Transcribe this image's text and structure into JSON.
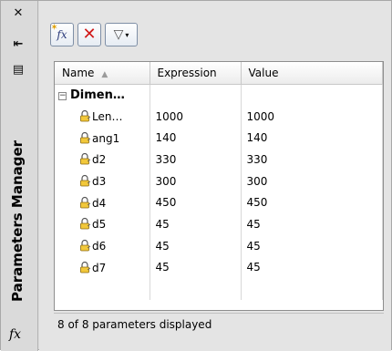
{
  "strip": {
    "close_glyph": "✕",
    "pin_glyph": "⇤",
    "menu_glyph": "▤",
    "title": "Parameters Manager",
    "fx_glyph": "fx"
  },
  "toolbar": {
    "new_param_label": "fx",
    "delete_label": "✕",
    "filter_label": "▽",
    "dropdown_glyph": "▾"
  },
  "table": {
    "headers": {
      "name": "Name",
      "expression": "Expression",
      "value": "Value"
    },
    "group": {
      "name": "Dimen…",
      "expander": "−"
    },
    "rows": [
      {
        "name": "Len…",
        "expression": "1000",
        "value": "1000"
      },
      {
        "name": "ang1",
        "expression": "140",
        "value": "140"
      },
      {
        "name": "d2",
        "expression": "330",
        "value": "330"
      },
      {
        "name": "d3",
        "expression": "300",
        "value": "300"
      },
      {
        "name": "d4",
        "expression": "450",
        "value": "450"
      },
      {
        "name": "d5",
        "expression": "45",
        "value": "45"
      },
      {
        "name": "d6",
        "expression": "45",
        "value": "45"
      },
      {
        "name": "d7",
        "expression": "45",
        "value": "45"
      }
    ]
  },
  "status": {
    "text": "8 of 8 parameters displayed"
  }
}
